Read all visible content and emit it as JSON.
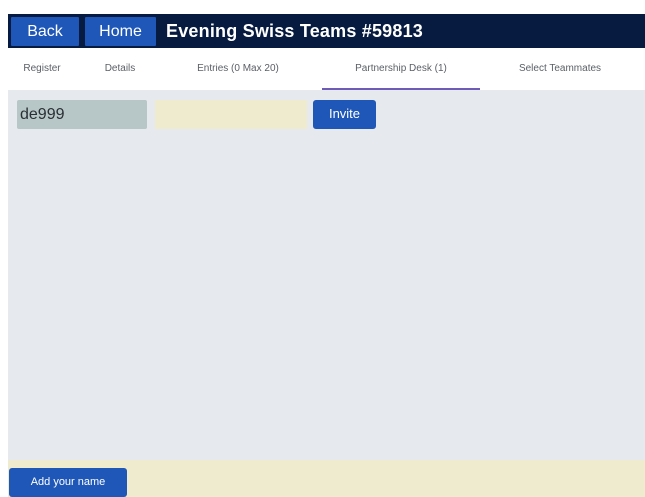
{
  "header": {
    "back_label": "Back",
    "home_label": "Home",
    "title": "Evening Swiss Teams #59813"
  },
  "tabs": [
    {
      "label": "Register",
      "active": false
    },
    {
      "label": "Details",
      "active": false
    },
    {
      "label": "Entries (0 Max 20)",
      "active": false
    },
    {
      "label": "Partnership Desk (1)",
      "active": true
    },
    {
      "label": "Select Teammates",
      "active": false
    }
  ],
  "partnership_desk": {
    "entries": [
      {
        "name": "de999",
        "message": "",
        "action_label": "Invite"
      }
    ]
  },
  "footer": {
    "add_name_label": "Add your name"
  },
  "colors": {
    "header_bg": "#061b3f",
    "button_blue": "#1f57b8",
    "content_bg": "#e6e9ed",
    "footer_bg": "#efebce",
    "active_tab_underline": "#6d5bb5"
  }
}
